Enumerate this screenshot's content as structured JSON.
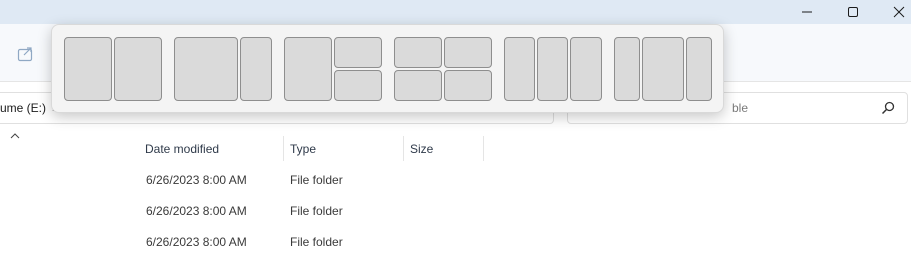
{
  "window": {
    "minimize_icon": "minimize-icon",
    "maximize_icon": "maximize-icon",
    "close_icon": "close-icon"
  },
  "toolbar": {
    "share_icon": "share-icon"
  },
  "address": {
    "segment": "ume (E:)",
    "chevron": "›"
  },
  "search": {
    "placeholder_fragment": "ble"
  },
  "columns": {
    "sort_caret": "^",
    "date": "Date modified",
    "type": "Type",
    "size": "Size"
  },
  "rows": [
    {
      "date": "6/26/2023 8:00 AM",
      "type": "File folder",
      "size": ""
    },
    {
      "date": "6/26/2023 8:00 AM",
      "type": "File folder",
      "size": ""
    },
    {
      "date": "6/26/2023 8:00 AM",
      "type": "File folder",
      "size": ""
    }
  ],
  "snap_layouts": {
    "layouts": [
      "two-halves",
      "wide-left-narrow-right",
      "left-and-right-stack",
      "four-quadrants",
      "three-columns",
      "narrow-wide-narrow"
    ]
  }
}
